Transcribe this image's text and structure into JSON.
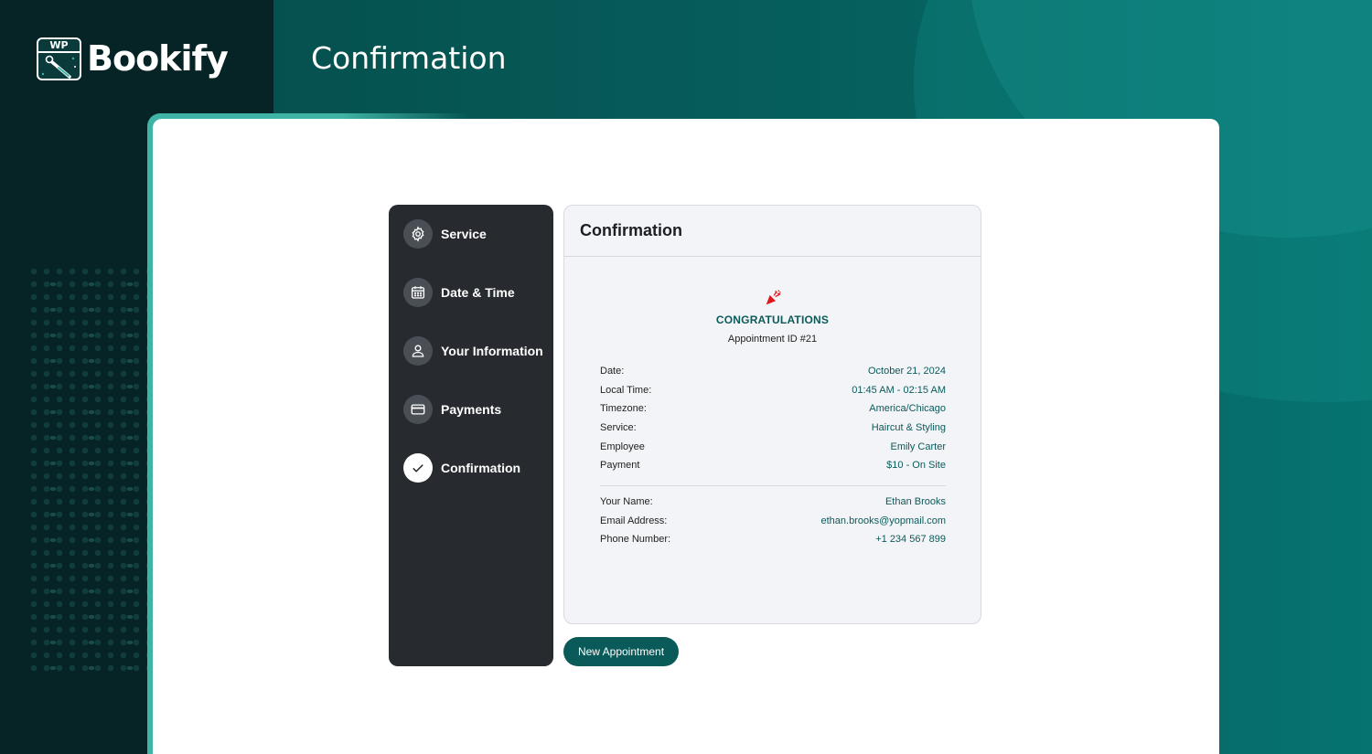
{
  "brand": {
    "badge_text": "WP",
    "name": "Bookify"
  },
  "header": {
    "title": "Confirmation"
  },
  "steps": [
    {
      "label": "Service",
      "icon": "gear-icon"
    },
    {
      "label": "Date & Time",
      "icon": "calendar-icon"
    },
    {
      "label": "Your Information",
      "icon": "user-icon"
    },
    {
      "label": "Payments",
      "icon": "credit-card-icon"
    },
    {
      "label": "Confirmation",
      "icon": "check-icon"
    }
  ],
  "panel": {
    "title": "Confirmation",
    "congrats_icon": "party-popper-icon",
    "congrats": "CONGRATULATIONS",
    "appointment_id": "Appointment ID #21",
    "details": [
      {
        "label": "Date:",
        "value": "October 21, 2024"
      },
      {
        "label": "Local Time:",
        "value": "01:45 AM - 02:15 AM"
      },
      {
        "label": "Timezone:",
        "value": "America/Chicago"
      },
      {
        "label": "Service:",
        "value": "Haircut & Styling"
      },
      {
        "label": "Employee",
        "value": "Emily Carter"
      },
      {
        "label": "Payment",
        "value": "$10 - On Site"
      }
    ],
    "contact": [
      {
        "label": "Your Name:",
        "value": "Ethan Brooks"
      },
      {
        "label": "Email Address:",
        "value": "ethan.brooks@yopmail.com"
      },
      {
        "label": "Phone Number:",
        "value": "+1 234 567 899"
      }
    ]
  },
  "actions": {
    "new_appointment": "New Appointment"
  },
  "colors": {
    "accent": "#0b5a5a",
    "sidebar": "#272a2f",
    "header": "#06605d"
  }
}
